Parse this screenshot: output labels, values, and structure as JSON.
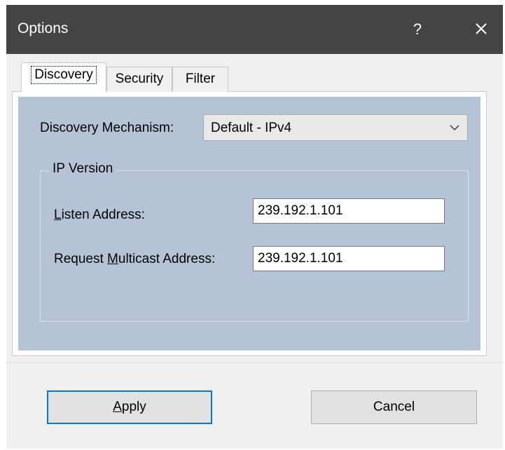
{
  "window": {
    "title": "Options",
    "help_label": "?"
  },
  "tabs": [
    {
      "label": "Discovery"
    },
    {
      "label": "Security"
    },
    {
      "label": "Filter"
    }
  ],
  "discovery": {
    "mechanism_label": "Discovery Mechanism:",
    "mechanism_value": "Default - IPv4",
    "group_title": "IP Version",
    "listen_label_mnemonic": "L",
    "listen_label_rest": "isten Address:",
    "listen_value": "239.192.1.101",
    "request_label_pre": "Request ",
    "request_label_mnemonic": "M",
    "request_label_rest": "ulticast Address:",
    "request_value": "239.192.1.101"
  },
  "buttons": {
    "apply_mnemonic": "A",
    "apply_rest": "pply",
    "cancel": "Cancel"
  },
  "colors": {
    "titlebar": "#444444",
    "panel": "#b4c4d6",
    "focus_border": "#0078d7"
  }
}
